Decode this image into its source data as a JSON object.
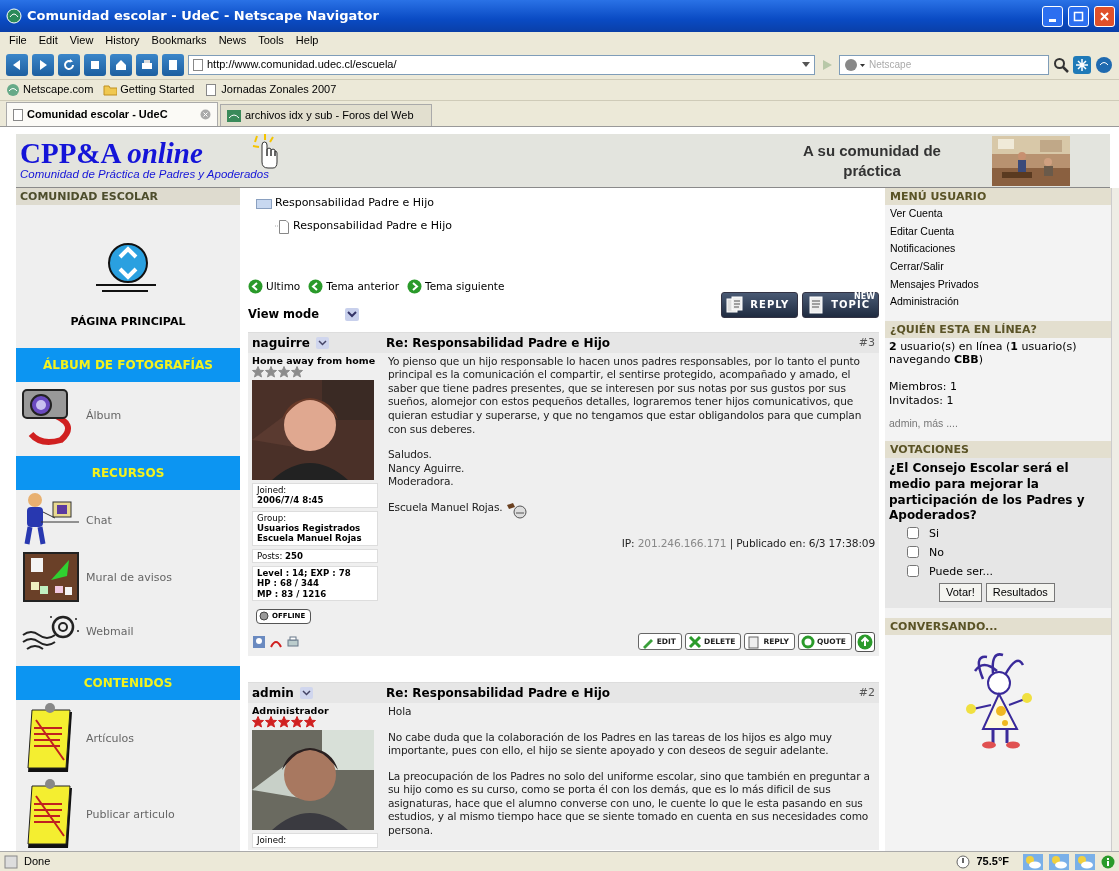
{
  "window": {
    "title": "Comunidad escolar - UdeC - Netscape Navigator"
  },
  "menu": [
    "File",
    "Edit",
    "View",
    "History",
    "Bookmarks",
    "News",
    "Tools",
    "Help"
  ],
  "address_bar": {
    "value": "http://www.comunidad.udec.cl/escuela/"
  },
  "search_field": {
    "placeholder": "Netscape"
  },
  "bookmarks": [
    {
      "label": "Netscape.com",
      "kind": "site"
    },
    {
      "label": "Getting Started",
      "kind": "folder"
    },
    {
      "label": "Jornadas Zonales 2007",
      "kind": "page"
    }
  ],
  "tabs": [
    {
      "label": "Comunidad escolar - UdeC",
      "selected": true
    },
    {
      "label": "archivos idx y sub - Foros del Web",
      "selected": false
    }
  ],
  "banner": {
    "logo": "CPP&A",
    "logo_accent": "online",
    "tagline": "Comunidad de Práctica de Padres y Apoderados",
    "slogan": "A su comunidad de práctica"
  },
  "left_sections": [
    {
      "title": "COMUNIDAD ESCOLAR",
      "kind": "plain",
      "items": [
        {
          "label": "PÁGINA PRINCIPAL",
          "kind": "home"
        }
      ]
    },
    {
      "title": "ÁLBUM DE FOTOGRAFÍAS",
      "kind": "banner",
      "items": [
        {
          "label": "Álbum",
          "kind": "camera"
        }
      ]
    },
    {
      "title": "RECURSOS",
      "kind": "banner",
      "items": [
        {
          "label": "Chat",
          "kind": "chat"
        },
        {
          "label": "Mural de avisos",
          "kind": "board"
        },
        {
          "label": "Webmail",
          "kind": "mail"
        }
      ]
    },
    {
      "title": "CONTENIDOS",
      "kind": "banner",
      "items": [
        {
          "label": "Artículos",
          "kind": "notice"
        },
        {
          "label": "Publicar articulo",
          "kind": "notice"
        }
      ]
    }
  ],
  "topic_tree": [
    {
      "label": "Responsabilidad Padre e Hijo",
      "children": [
        {
          "label": "Responsabilidad Padre e Hijo"
        }
      ]
    }
  ],
  "topic_nav": [
    "Ultimo",
    "Tema anterior",
    "Tema siguiente"
  ],
  "topic_buttons": [
    {
      "label": "REPLY",
      "kind": "reply"
    },
    {
      "label": "TOPIC",
      "kind": "new",
      "badge": "NEW"
    }
  ],
  "view_mode": "View mode",
  "posts": [
    {
      "user": "naguirre",
      "rank": "Home away from home",
      "stars": 4,
      "color": "#8c8c8c",
      "subject": "Re: Responsabilidad Padre e Hijo",
      "number": "#3",
      "body": [
        "Yo pienso que un hijo responsable lo hacen unos padres responsables, por lo tanto el punto principal es la comunicación el compartir, el sentirse protegido, acompañado y amado, el saber que tiene padres presentes, que se interesen por sus notas por sus gustos por sus sueños, alomejor con estos pequeños detalles, lograremos tener hijos comunicativos, que quieran estudiar y superarse, y que no tengamos que estar obligandolos para que cumplan con sus deberes.",
        "Saludos.\nNancy Aguirre.\nModeradora."
      ],
      "signature": "Escuela Manuel Rojas.",
      "profile": [
        {
          "label": "Joined:",
          "value": "2006/7/4 8:45"
        },
        {
          "label": "Group:",
          "value": "Usuarios Registrados\nEscuela Manuel Rojas"
        },
        {
          "label": "Posts:",
          "value": "250"
        },
        {
          "value": "Level : 14; EXP : 78\nHP : 68 / 344\nMP : 83 / 1216"
        }
      ],
      "status": "OFFLINE",
      "ip_label": "IP:",
      "ip": "201.246.166.171",
      "published": "| Publicado en: 6/3 17:38:09",
      "actions": [
        "EDIT",
        "DELETE",
        "REPLY",
        "QUOTE"
      ]
    },
    {
      "user": "admin",
      "rank": "Administrador",
      "stars": 5,
      "color": "#d02020",
      "subject": "Re: Responsabilidad Padre e Hijo",
      "number": "#2",
      "body": [
        "Hola",
        "No cabe duda que la colaboración de los Padres en las tareas de los hijos es algo muy importante, pues con ello, el hijo se siente apoyado y con deseos de seguir adelante.",
        "La preocupación de los Padres no solo del uniforme escolar, sino que también en preguntar a su hijo como es su curso, como se porta él con los demás, que es lo más dificil de sus asignaturas, hace que el alumno converse con uno, le cuente lo que le esta pasando en sus estudios, y al mismo tiempo hace que se siente tomado en cuenta en sus necesidades como persona."
      ],
      "profile": [
        {
          "label": "Joined:"
        }
      ]
    }
  ],
  "user_menu": {
    "title": "MENÚ USUARIO",
    "items": [
      "Ver Cuenta",
      "Editar Cuenta",
      "Notificaciones",
      "Cerrar/Salir",
      "Mensajes Privados",
      "Administración"
    ]
  },
  "who_online": {
    "title": "¿QUIÉN ESTA EN LÍNEA?",
    "summary": "**2** usuario(s) en línea (**1** usuario(s) navegando **CBB**)",
    "counts": "Miembros: 1\nInvitados: 1",
    "user_link": "admin",
    "more": ", más ...."
  },
  "poll": {
    "title": "VOTACIONES",
    "question": "¿El Consejo Escolar será el medio para mejorar la participación de los Padres y Apoderados?",
    "options": [
      {
        "label": "Si",
        "checked": false
      },
      {
        "label": "No",
        "checked": false
      },
      {
        "label": "Puede ser...",
        "checked": false
      }
    ],
    "buttons": [
      "Votar!",
      "Resultados"
    ]
  },
  "chat_box": {
    "title": "CONVERSANDO..."
  },
  "status_bar": {
    "text": "Done",
    "temperature": "75.5°F"
  }
}
